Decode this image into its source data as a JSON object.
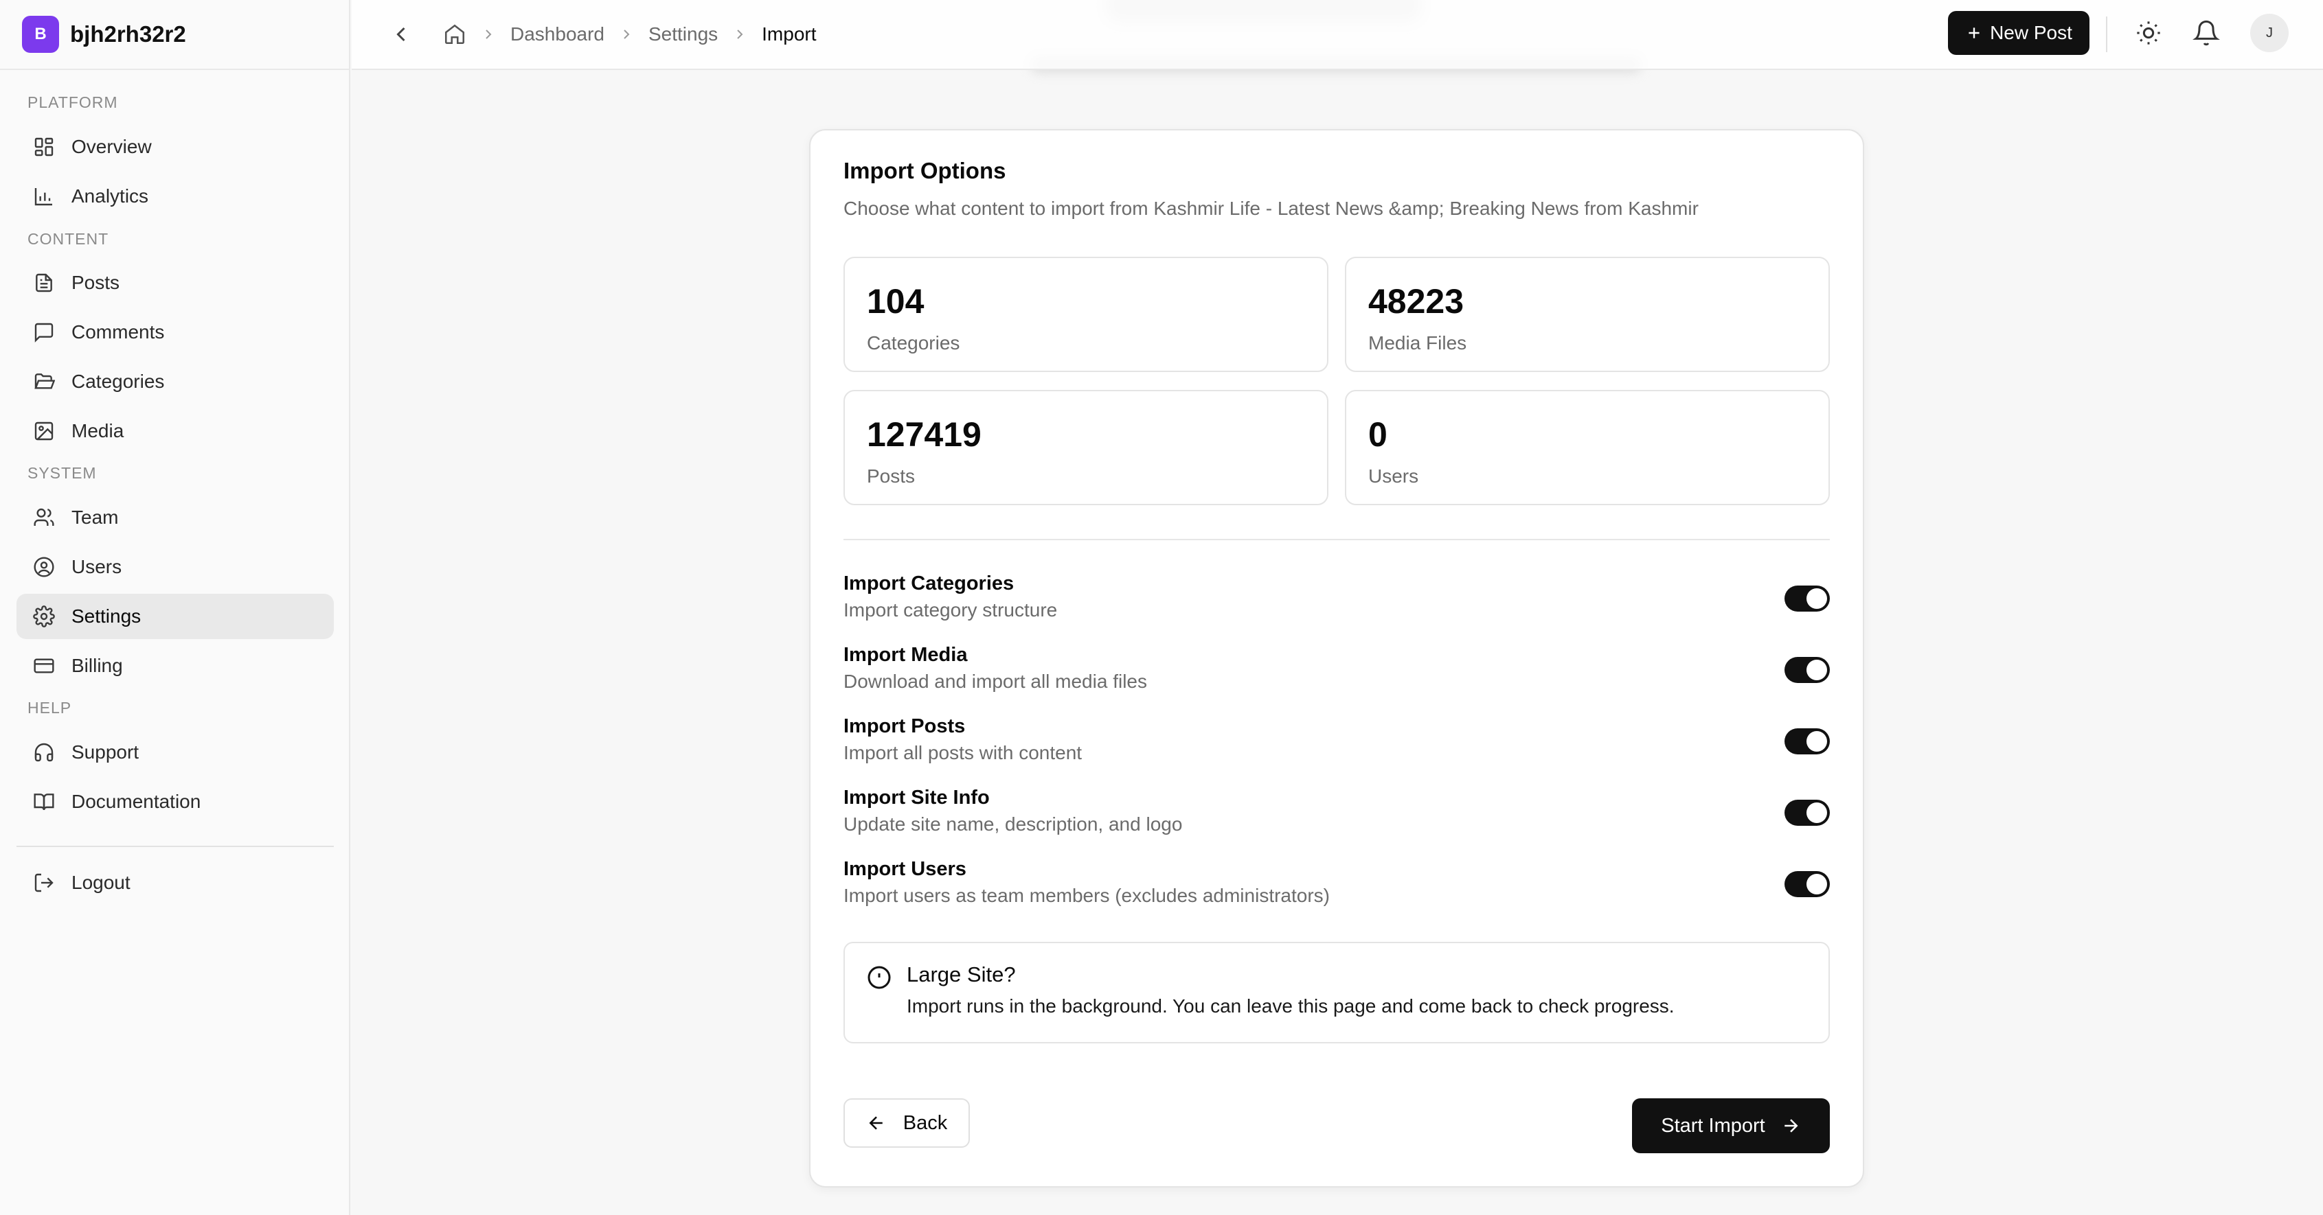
{
  "app": {
    "logo_letter": "B",
    "name": "bjh2rh32r2"
  },
  "sidebar": {
    "sections": [
      {
        "label": "PLATFORM"
      },
      {
        "label": "CONTENT"
      },
      {
        "label": "SYSTEM"
      },
      {
        "label": "HELP"
      }
    ],
    "items": [
      {
        "label": "Overview",
        "icon": "grid-icon"
      },
      {
        "label": "Analytics",
        "icon": "bar-chart-icon"
      },
      {
        "label": "Posts",
        "icon": "file-text-icon"
      },
      {
        "label": "Comments",
        "icon": "message-square-icon"
      },
      {
        "label": "Categories",
        "icon": "folder-open-icon"
      },
      {
        "label": "Media",
        "icon": "image-icon"
      },
      {
        "label": "Team",
        "icon": "users-icon"
      },
      {
        "label": "Users",
        "icon": "user-circle-icon"
      },
      {
        "label": "Settings",
        "icon": "gear-icon",
        "active": true
      },
      {
        "label": "Billing",
        "icon": "credit-card-icon"
      },
      {
        "label": "Support",
        "icon": "headphones-icon"
      },
      {
        "label": "Documentation",
        "icon": "book-open-icon"
      }
    ],
    "logout": {
      "label": "Logout",
      "icon": "logout-icon"
    }
  },
  "topbar": {
    "breadcrumb": [
      "Dashboard",
      "Settings",
      "Import"
    ],
    "new_post_label": "New Post",
    "avatar_initial": "J"
  },
  "card": {
    "title": "Import Options",
    "description": "Choose what content to import from Kashmir Life - Latest News &amp; Breaking News from Kashmir",
    "stats": [
      {
        "value": "104",
        "label": "Categories"
      },
      {
        "value": "48223",
        "label": "Media Files"
      },
      {
        "value": "127419",
        "label": "Posts"
      },
      {
        "value": "0",
        "label": "Users"
      }
    ],
    "options": [
      {
        "title": "Import Categories",
        "description": "Import category structure",
        "enabled": true
      },
      {
        "title": "Import Media",
        "description": "Download and import all media files",
        "enabled": true
      },
      {
        "title": "Import Posts",
        "description": "Import all posts with content",
        "enabled": true
      },
      {
        "title": "Import Site Info",
        "description": "Update site name, description, and logo",
        "enabled": true
      },
      {
        "title": "Import Users",
        "description": "Import users as team members (excludes administrators)",
        "enabled": true
      }
    ],
    "alert": {
      "title": "Large Site?",
      "text": "Import runs in the background. You can leave this page and come back to check progress."
    },
    "back_label": "Back",
    "start_label": "Start Import"
  },
  "colors": {
    "brand": "#7c3aed",
    "primary": "#111111",
    "muted_text": "#6b6b6b"
  }
}
